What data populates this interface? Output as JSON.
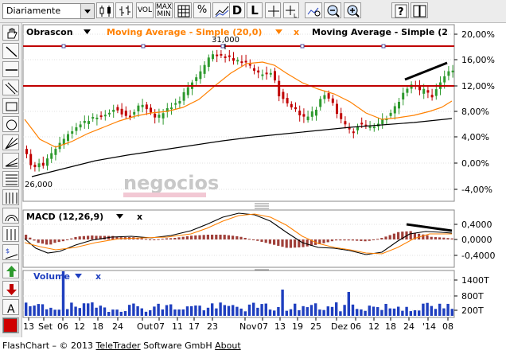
{
  "toolbar": {
    "period_select": "Diariamente",
    "buttons": {
      "vol": "VOL",
      "max": "MAX",
      "min": "MIN",
      "percent": "%",
      "d": "D",
      "l": "L"
    }
  },
  "main_chart": {
    "instrument": "Obrascon",
    "ma20_label": "Moving Average - Simple (20,0)",
    "ma200_label": "Moving Average - Simple (2",
    "close_x": "x",
    "high_label": "31,000",
    "low_label": "26,000",
    "watermark": "negocios",
    "y_ticks": [
      "20,00%",
      "16,00%",
      "12,00%",
      "8,00%",
      "4,00%",
      "0,00%",
      "-4,00%"
    ]
  },
  "macd_chart": {
    "label": "MACD (12,26,9)",
    "close_x": "x",
    "y_ticks": [
      "0,4000",
      "0,0000",
      "-0,4000"
    ]
  },
  "volume_chart": {
    "label": "Volume",
    "close_x": "x",
    "y_ticks": [
      "1400T",
      "800T",
      "200T"
    ]
  },
  "x_axis": {
    "labels": [
      "13",
      "Set",
      "06",
      "12",
      "18",
      "24",
      "Out",
      "07",
      "11",
      "17",
      "23",
      "Nov",
      "07",
      "13",
      "19",
      "25",
      "Dez",
      "06",
      "12",
      "18",
      "24",
      "'14",
      "08"
    ]
  },
  "footer": {
    "prefix": "FlashChart – © 2013 ",
    "company_a": "TeleTrader",
    "company_b": " Software GmbH ",
    "about": "About"
  },
  "colors": {
    "red_lines": "#c00000",
    "ma20": "#ff8000",
    "ma200": "#000000",
    "candle_up": "#2e9a2e",
    "candle_down": "#c00000",
    "volume": "#1f3fbf",
    "macd_bar": "#a0403a"
  }
}
